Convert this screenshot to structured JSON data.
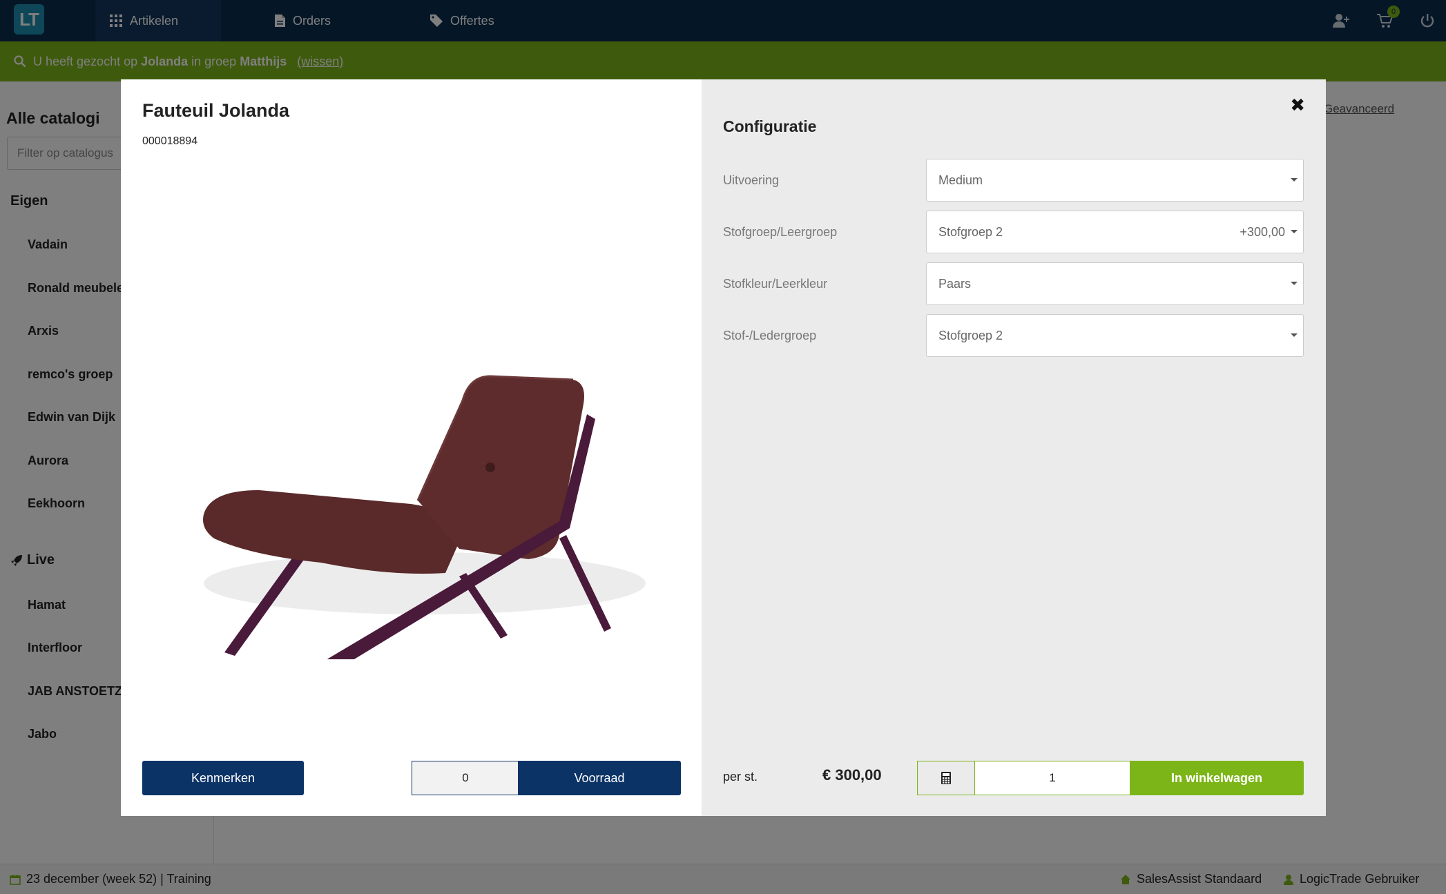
{
  "app": {
    "logo": "LT"
  },
  "nav": {
    "items": [
      {
        "label": "Artikelen",
        "icon": "grid-icon"
      },
      {
        "label": "Orders",
        "icon": "document-icon"
      },
      {
        "label": "Offertes",
        "icon": "tag-icon"
      }
    ],
    "cart_count": "0"
  },
  "banner": {
    "text_prefix": "U heeft gezocht op",
    "query": "Jolanda",
    "text_mid": "in groep",
    "group": "Matthijs",
    "clear_link": "(wissen)"
  },
  "sidebar": {
    "title": "Alle catalogi",
    "filter_placeholder": "Filter op catalogus",
    "groups": [
      {
        "title": "Eigen",
        "items": [
          "Vadain",
          "Ronald meubelen",
          "Arxis",
          "remco's groep",
          "Edwin van Dijk",
          "Aurora",
          "Eekhoorn"
        ]
      },
      {
        "title": "Live",
        "items": [
          "Hamat",
          "Interfloor",
          "JAB ANSTOETZ",
          "Jabo"
        ]
      }
    ],
    "advanced_link": "Geavanceerd"
  },
  "footer": {
    "date": "23 december (week 52) | Training",
    "profile": "SalesAssist Standaard",
    "user": "LogicTrade Gebruiker"
  },
  "modal": {
    "title": "Fauteuil Jolanda",
    "code": "000018894",
    "kenmerken_label": "Kenmerken",
    "stock_value": "0",
    "voorraad_label": "Voorraad",
    "config": {
      "title": "Configuratie",
      "rows": [
        {
          "label": "Uitvoering",
          "value": "Medium",
          "extra": ""
        },
        {
          "label": "Stofgroep/Leergroep",
          "value": "Stofgroep 2",
          "extra": "+300,00"
        },
        {
          "label": "Stofkleur/Leerkleur",
          "value": "Paars",
          "extra": ""
        },
        {
          "label": "Stof-/Ledergroep",
          "value": "Stofgroep 2",
          "extra": ""
        }
      ]
    },
    "per_unit_label": "per st.",
    "price": "€ 300,00",
    "quantity": "1",
    "add_to_cart_label": "In winkelwagen"
  },
  "colors": {
    "navy": "#0b2c4e",
    "green": "#7cb518",
    "button_navy": "#0b3366",
    "fabric": "#5a2a2a",
    "frame": "#4a1a3a"
  }
}
